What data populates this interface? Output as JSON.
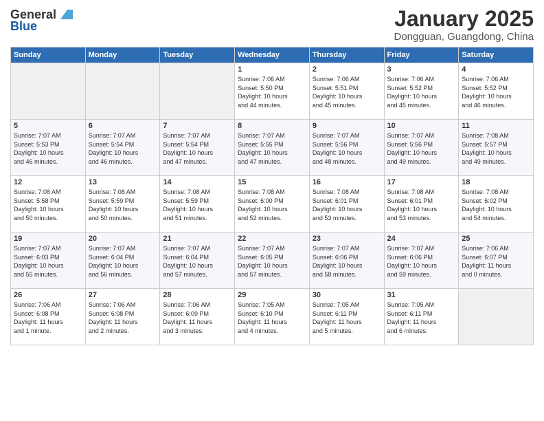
{
  "logo": {
    "general": "General",
    "blue": "Blue"
  },
  "header": {
    "month": "January 2025",
    "location": "Dongguan, Guangdong, China"
  },
  "weekdays": [
    "Sunday",
    "Monday",
    "Tuesday",
    "Wednesday",
    "Thursday",
    "Friday",
    "Saturday"
  ],
  "weeks": [
    [
      {
        "day": "",
        "info": ""
      },
      {
        "day": "",
        "info": ""
      },
      {
        "day": "",
        "info": ""
      },
      {
        "day": "1",
        "info": "Sunrise: 7:06 AM\nSunset: 5:50 PM\nDaylight: 10 hours\nand 44 minutes."
      },
      {
        "day": "2",
        "info": "Sunrise: 7:06 AM\nSunset: 5:51 PM\nDaylight: 10 hours\nand 45 minutes."
      },
      {
        "day": "3",
        "info": "Sunrise: 7:06 AM\nSunset: 5:52 PM\nDaylight: 10 hours\nand 45 minutes."
      },
      {
        "day": "4",
        "info": "Sunrise: 7:06 AM\nSunset: 5:52 PM\nDaylight: 10 hours\nand 46 minutes."
      }
    ],
    [
      {
        "day": "5",
        "info": "Sunrise: 7:07 AM\nSunset: 5:53 PM\nDaylight: 10 hours\nand 46 minutes."
      },
      {
        "day": "6",
        "info": "Sunrise: 7:07 AM\nSunset: 5:54 PM\nDaylight: 10 hours\nand 46 minutes."
      },
      {
        "day": "7",
        "info": "Sunrise: 7:07 AM\nSunset: 5:54 PM\nDaylight: 10 hours\nand 47 minutes."
      },
      {
        "day": "8",
        "info": "Sunrise: 7:07 AM\nSunset: 5:55 PM\nDaylight: 10 hours\nand 47 minutes."
      },
      {
        "day": "9",
        "info": "Sunrise: 7:07 AM\nSunset: 5:56 PM\nDaylight: 10 hours\nand 48 minutes."
      },
      {
        "day": "10",
        "info": "Sunrise: 7:07 AM\nSunset: 5:56 PM\nDaylight: 10 hours\nand 49 minutes."
      },
      {
        "day": "11",
        "info": "Sunrise: 7:08 AM\nSunset: 5:57 PM\nDaylight: 10 hours\nand 49 minutes."
      }
    ],
    [
      {
        "day": "12",
        "info": "Sunrise: 7:08 AM\nSunset: 5:58 PM\nDaylight: 10 hours\nand 50 minutes."
      },
      {
        "day": "13",
        "info": "Sunrise: 7:08 AM\nSunset: 5:59 PM\nDaylight: 10 hours\nand 50 minutes."
      },
      {
        "day": "14",
        "info": "Sunrise: 7:08 AM\nSunset: 5:59 PM\nDaylight: 10 hours\nand 51 minutes."
      },
      {
        "day": "15",
        "info": "Sunrise: 7:08 AM\nSunset: 6:00 PM\nDaylight: 10 hours\nand 52 minutes."
      },
      {
        "day": "16",
        "info": "Sunrise: 7:08 AM\nSunset: 6:01 PM\nDaylight: 10 hours\nand 53 minutes."
      },
      {
        "day": "17",
        "info": "Sunrise: 7:08 AM\nSunset: 6:01 PM\nDaylight: 10 hours\nand 53 minutes."
      },
      {
        "day": "18",
        "info": "Sunrise: 7:08 AM\nSunset: 6:02 PM\nDaylight: 10 hours\nand 54 minutes."
      }
    ],
    [
      {
        "day": "19",
        "info": "Sunrise: 7:07 AM\nSunset: 6:03 PM\nDaylight: 10 hours\nand 55 minutes."
      },
      {
        "day": "20",
        "info": "Sunrise: 7:07 AM\nSunset: 6:04 PM\nDaylight: 10 hours\nand 56 minutes."
      },
      {
        "day": "21",
        "info": "Sunrise: 7:07 AM\nSunset: 6:04 PM\nDaylight: 10 hours\nand 57 minutes."
      },
      {
        "day": "22",
        "info": "Sunrise: 7:07 AM\nSunset: 6:05 PM\nDaylight: 10 hours\nand 57 minutes."
      },
      {
        "day": "23",
        "info": "Sunrise: 7:07 AM\nSunset: 6:06 PM\nDaylight: 10 hours\nand 58 minutes."
      },
      {
        "day": "24",
        "info": "Sunrise: 7:07 AM\nSunset: 6:06 PM\nDaylight: 10 hours\nand 59 minutes."
      },
      {
        "day": "25",
        "info": "Sunrise: 7:06 AM\nSunset: 6:07 PM\nDaylight: 11 hours\nand 0 minutes."
      }
    ],
    [
      {
        "day": "26",
        "info": "Sunrise: 7:06 AM\nSunset: 6:08 PM\nDaylight: 11 hours\nand 1 minute."
      },
      {
        "day": "27",
        "info": "Sunrise: 7:06 AM\nSunset: 6:08 PM\nDaylight: 11 hours\nand 2 minutes."
      },
      {
        "day": "28",
        "info": "Sunrise: 7:06 AM\nSunset: 6:09 PM\nDaylight: 11 hours\nand 3 minutes."
      },
      {
        "day": "29",
        "info": "Sunrise: 7:05 AM\nSunset: 6:10 PM\nDaylight: 11 hours\nand 4 minutes."
      },
      {
        "day": "30",
        "info": "Sunrise: 7:05 AM\nSunset: 6:11 PM\nDaylight: 11 hours\nand 5 minutes."
      },
      {
        "day": "31",
        "info": "Sunrise: 7:05 AM\nSunset: 6:11 PM\nDaylight: 11 hours\nand 6 minutes."
      },
      {
        "day": "",
        "info": ""
      }
    ]
  ]
}
